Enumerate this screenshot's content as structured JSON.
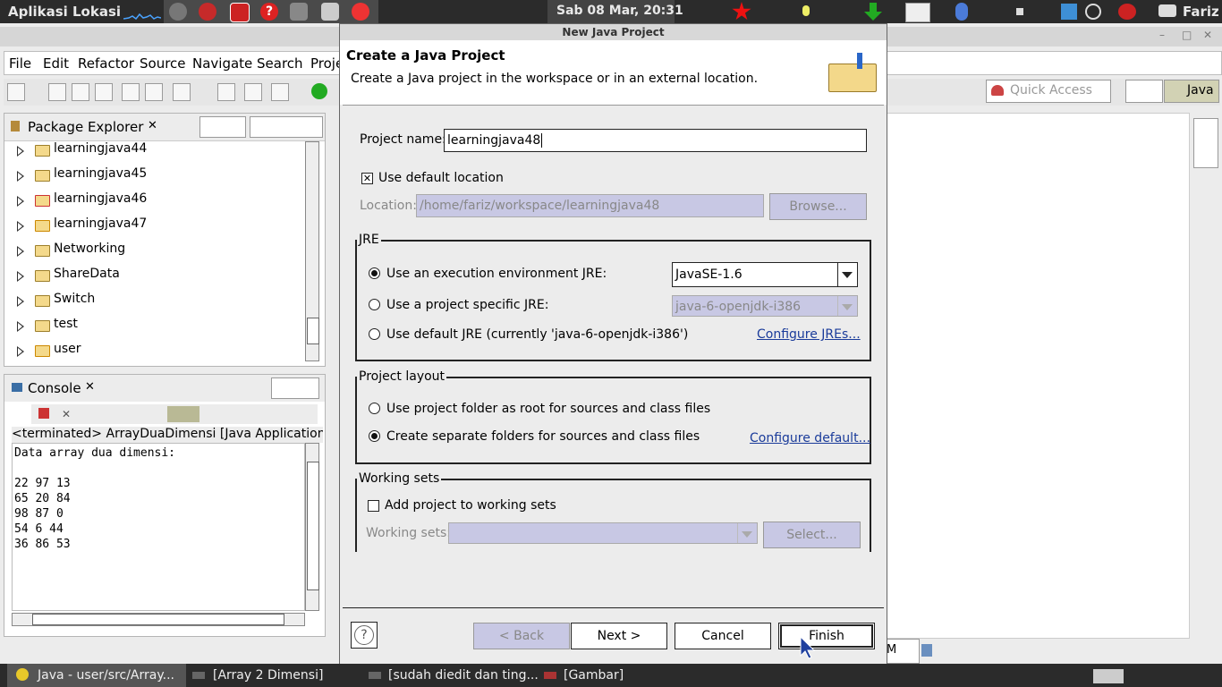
{
  "top_panel": {
    "menu_apps": "Aplikasi",
    "menu_places": "Lokasi",
    "clock": "Sab 08 Mar, 20:31",
    "user": "Fariz"
  },
  "eclipse": {
    "menu": [
      "File",
      "Edit",
      "Refactor",
      "Source",
      "Navigate",
      "Search",
      "Proje"
    ],
    "quick_access_placeholder": "Quick Access",
    "perspective": "Java",
    "package_explorer": {
      "title": "Package Explorer",
      "items": [
        "learningjava44",
        "learningjava45",
        "learningjava46",
        "learningjava47",
        "Networking",
        "ShareData",
        "Switch",
        "test",
        "user"
      ]
    },
    "console": {
      "title": "Console",
      "header": "<terminated> ArrayDuaDimensi [Java Application] /usr",
      "lines": [
        "Data array dua dimensi:",
        "",
        "22 97 13",
        "65 20 84",
        "98 87 0",
        "54 6 44",
        "36 86 53"
      ]
    },
    "status_frag": "M"
  },
  "dialog": {
    "window_title": "New Java Project",
    "heading": "Create a Java Project",
    "subtitle": "Create a Java project in the workspace or in an external location.",
    "project_name_label": "Project name:",
    "project_name_value": "learningjava48",
    "use_default_location": "Use default location",
    "location_label": "Location:",
    "location_value": "/home/fariz/workspace/learningjava48",
    "browse": "Browse...",
    "jre": {
      "group": "JRE",
      "opt_env": "Use an execution environment JRE:",
      "env_value": "JavaSE-1.6",
      "opt_specific": "Use a project specific JRE:",
      "specific_value": "java-6-openjdk-i386",
      "opt_default": "Use default JRE (currently 'java-6-openjdk-i386')",
      "configure_link": "Configure JREs..."
    },
    "layout": {
      "group": "Project layout",
      "opt_root": "Use project folder as root for sources and class files",
      "opt_separate": "Create separate folders for sources and class files",
      "configure_link": "Configure default..."
    },
    "working_sets": {
      "group": "Working sets",
      "add": "Add project to working sets",
      "label": "Working sets:",
      "select": "Select..."
    },
    "buttons": {
      "back": "< Back",
      "next": "Next >",
      "cancel": "Cancel",
      "finish": "Finish"
    }
  },
  "taskbar": {
    "items": [
      "Java - user/src/Array...",
      "[Array 2 Dimensi]",
      "[sudah diedit dan ting...",
      "[Gambar]"
    ]
  }
}
